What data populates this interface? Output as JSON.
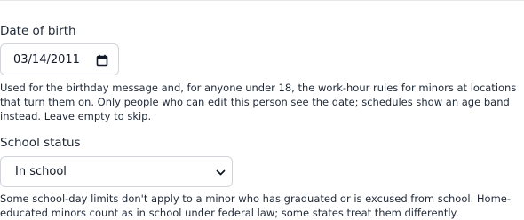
{
  "dob": {
    "label": "Date of birth",
    "value": "03/14/2011",
    "help": "Used for the birthday message and, for anyone under 18, the work-hour rules for minors at locations that turn them on. Only people who can edit this person see the date; schedules show an age band instead. Leave empty to skip."
  },
  "school": {
    "label": "School status",
    "selected": "In school",
    "help": "Some school-day limits don't apply to a minor who has graduated or is excused from school. Home-educated minors count as in school under federal law; some states treat them differently."
  },
  "icons": {
    "calendar": "calendar-icon",
    "chevron": "chevron-down-icon"
  }
}
